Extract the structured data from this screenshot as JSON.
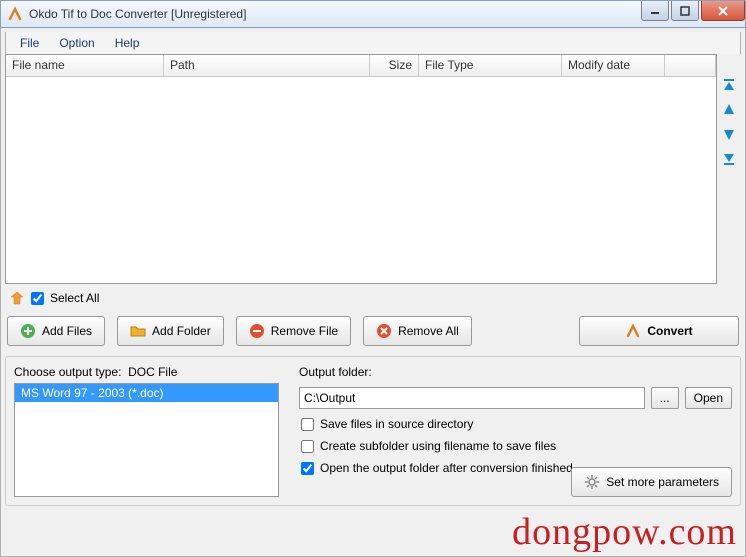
{
  "window": {
    "title": "Okdo Tif to Doc Converter [Unregistered]"
  },
  "menu": {
    "file": "File",
    "option": "Option",
    "help": "Help"
  },
  "columns": {
    "filename": "File name",
    "path": "Path",
    "size": "Size",
    "filetype": "File Type",
    "modify": "Modify date"
  },
  "select_all": "Select All",
  "buttons": {
    "add_files": "Add Files",
    "add_folder": "Add Folder",
    "remove_file": "Remove File",
    "remove_all": "Remove All",
    "convert": "Convert"
  },
  "output_type": {
    "label_prefix": "Choose output type:",
    "label_value": "DOC File",
    "selected": "MS Word 97 - 2003 (*.doc)"
  },
  "output_folder": {
    "label": "Output folder:",
    "value": "C:\\Output",
    "browse": "...",
    "open": "Open"
  },
  "checks": {
    "save_source": "Save files in source directory",
    "subfolder": "Create subfolder using filename to save files",
    "open_after": "Open the output folder after conversion finished"
  },
  "more_params": "Set more parameters",
  "watermark": "dongpow.com"
}
